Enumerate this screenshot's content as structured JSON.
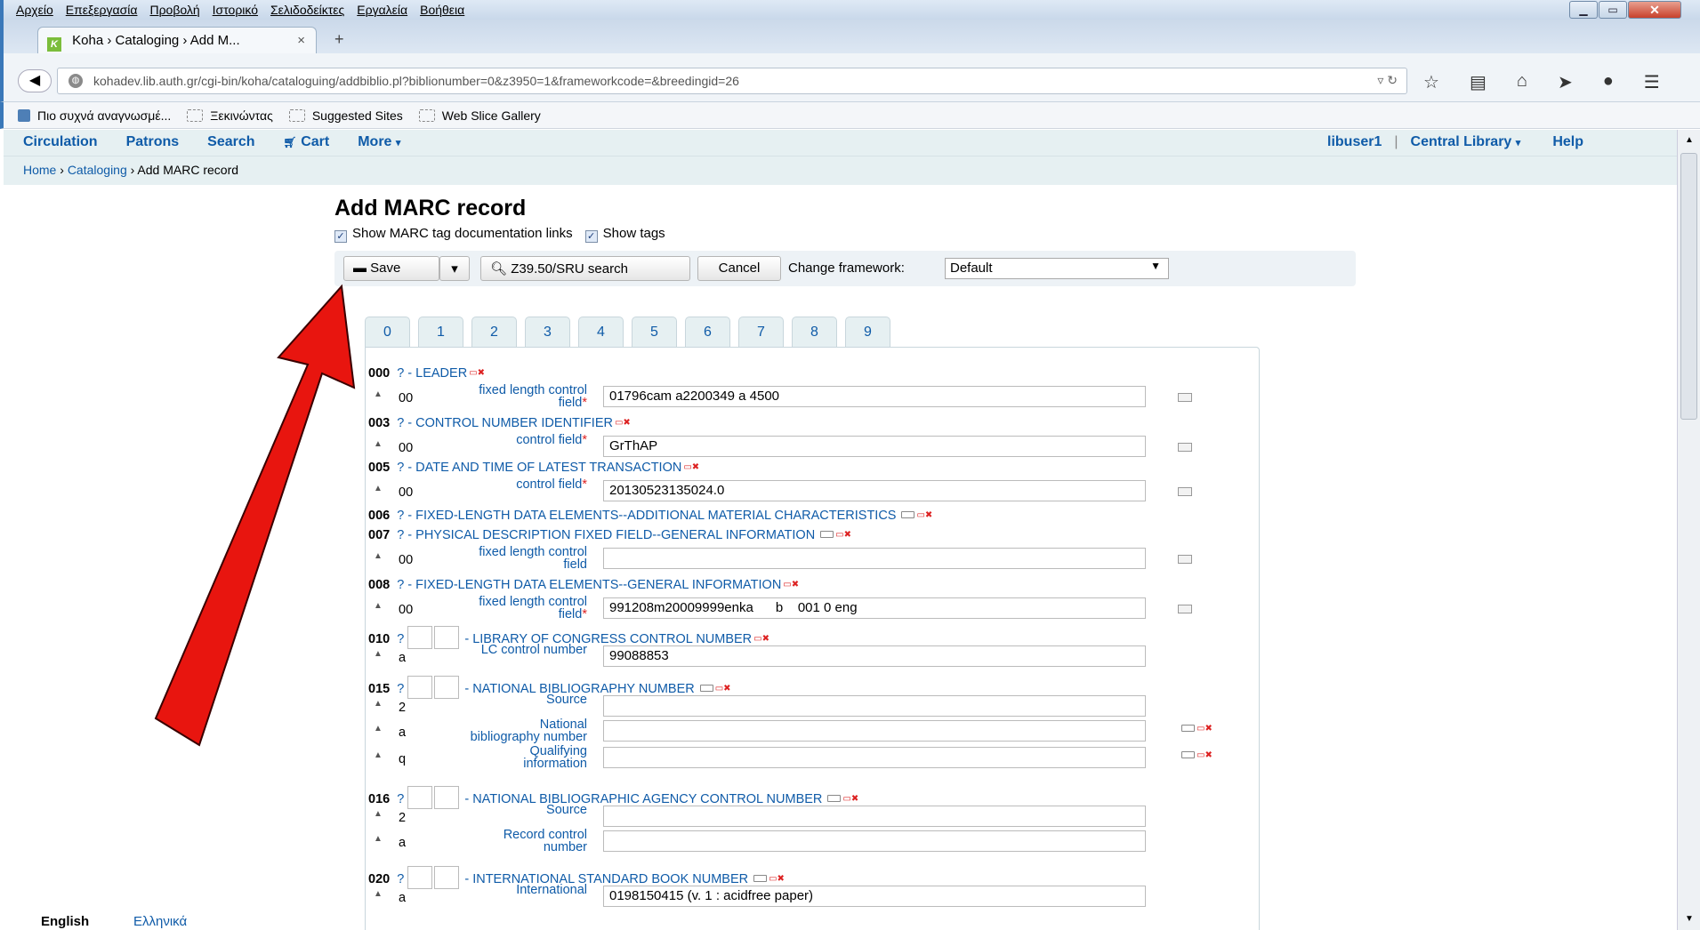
{
  "browser": {
    "menu": [
      "Αρχείο",
      "Επεξεργασία",
      "Προβολή",
      "Ιστορικό",
      "Σελιδοδείκτες",
      "Εργαλεία",
      "Βοήθεια"
    ],
    "tab_title": "Koha › Cataloging › Add M...",
    "tab_close": "×",
    "new_tab": "+",
    "url": "kohadev.lib.auth.gr/cgi-bin/koha/cataloguing/addbiblio.pl?biblionumber=0&z3950=1&frameworkcode=&breedingid=26",
    "bookmarks": [
      "Πιο συχνά αναγνωσμέ...",
      "Ξεκινώντας",
      "Suggested Sites",
      "Web Slice Gallery"
    ]
  },
  "koha_nav": {
    "left": [
      "Circulation",
      "Patrons",
      "Search",
      "Cart",
      "More"
    ],
    "user": "libuser1",
    "library": "Central Library",
    "help": "Help"
  },
  "breadcrumbs": {
    "home": "Home",
    "cataloging": "Cataloging",
    "current": "Add MARC record"
  },
  "title": "Add MARC record",
  "options": {
    "show_doc_links": "Show MARC tag documentation links",
    "show_tags": "Show tags"
  },
  "toolbar": {
    "save": "Save",
    "z3950": "Z39.50/SRU search",
    "cancel": "Cancel",
    "change_framework": "Change framework:",
    "framework": "Default"
  },
  "tabs": [
    "0",
    "1",
    "2",
    "3",
    "4",
    "5",
    "6",
    "7",
    "8",
    "9"
  ],
  "fields": {
    "f000": {
      "tag": "000",
      "label": "? - LEADER"
    },
    "f003": {
      "tag": "003",
      "label": "? - CONTROL NUMBER IDENTIFIER"
    },
    "f005": {
      "tag": "005",
      "label": "? - DATE AND TIME OF LATEST TRANSACTION"
    },
    "f006": {
      "tag": "006",
      "label": "? - FIXED-LENGTH DATA ELEMENTS--ADDITIONAL MATERIAL CHARACTERISTICS"
    },
    "f007": {
      "tag": "007",
      "label": "? - PHYSICAL DESCRIPTION FIXED FIELD--GENERAL INFORMATION"
    },
    "f008": {
      "tag": "008",
      "label": "? - FIXED-LENGTH DATA ELEMENTS--GENERAL INFORMATION"
    },
    "f010": {
      "tag": "010",
      "q": "?",
      "label": "- LIBRARY OF CONGRESS CONTROL NUMBER"
    },
    "f015": {
      "tag": "015",
      "q": "?",
      "label": "- NATIONAL BIBLIOGRAPHY NUMBER"
    },
    "f016": {
      "tag": "016",
      "q": "?",
      "label": "- NATIONAL BIBLIOGRAPHIC AGENCY CONTROL NUMBER"
    },
    "f020": {
      "tag": "020",
      "q": "?",
      "label": "- INTERNATIONAL STANDARD BOOK NUMBER"
    }
  },
  "subfields": {
    "s000": {
      "code": "00",
      "label1": "fixed length control",
      "label2": "field",
      "mand": "*",
      "value": "01796cam a2200349 a 4500"
    },
    "s003": {
      "code": "00",
      "label1": "control field",
      "mand": "*",
      "value": "GrThAP"
    },
    "s005": {
      "code": "00",
      "label1": "control field",
      "mand": "*",
      "value": "20130523135024.0"
    },
    "s007": {
      "code": "00",
      "label1": "fixed length control",
      "label2": "field",
      "value": ""
    },
    "s008": {
      "code": "00",
      "label1": "fixed length control",
      "label2": "field",
      "mand": "*",
      "value": "991208m20009999enka      b    001 0 eng"
    },
    "s010a": {
      "code": "a",
      "label1": "LC control number",
      "value": "99088853"
    },
    "s015_2": {
      "code": "2",
      "label1": "Source",
      "value": ""
    },
    "s015a": {
      "code": "a",
      "label1": "National",
      "label2": "bibliography number",
      "value": ""
    },
    "s015q": {
      "code": "q",
      "label1": "Qualifying",
      "label2": "information",
      "value": ""
    },
    "s016_2": {
      "code": "2",
      "label1": "Source",
      "value": ""
    },
    "s016a": {
      "code": "a",
      "label1": "Record control",
      "label2": "number",
      "value": ""
    },
    "s020a": {
      "code": "a",
      "label1": "International",
      "value": "0198150415 (v. 1 : acidfree paper)"
    }
  },
  "languages": {
    "english": "English",
    "greek": "Ελληνικά"
  },
  "colors": {
    "link": "#0f5ba8",
    "arrow": "#e8150f",
    "nav_bg": "#e6f0f2"
  }
}
